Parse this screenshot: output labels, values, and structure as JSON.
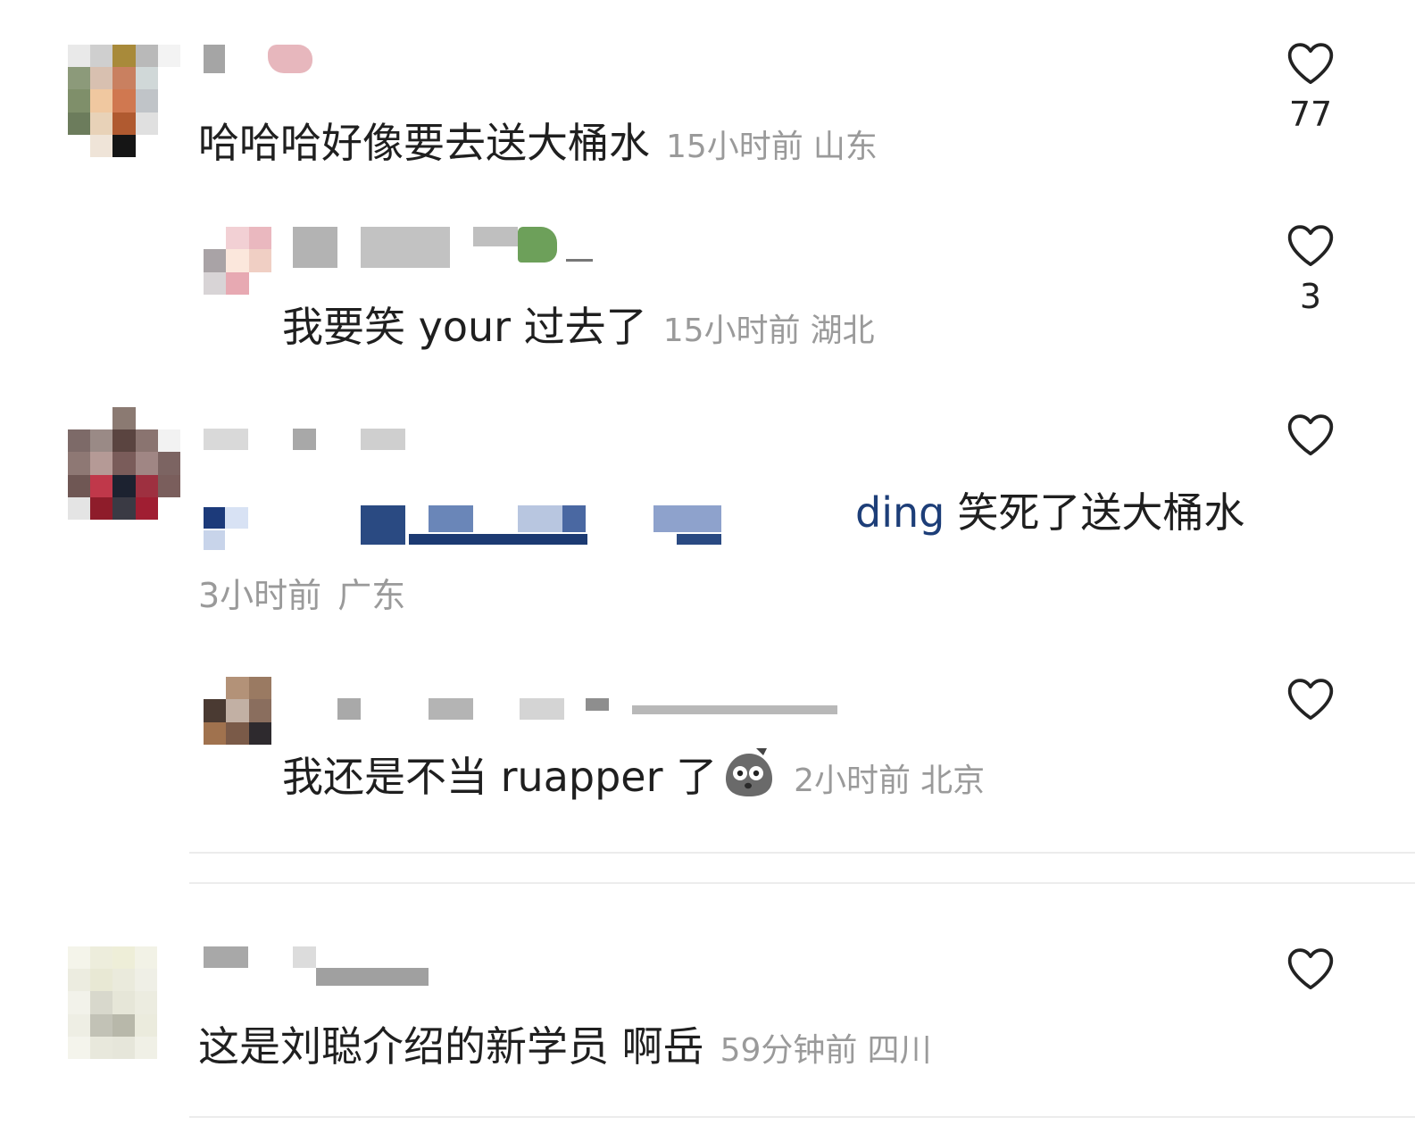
{
  "comments": [
    {
      "text": "哈哈哈好像要去送大桶水",
      "time": "15小时前",
      "location": "山东",
      "likes": "77"
    },
    {
      "text": "我要笑 your 过去了",
      "time": "15小时前",
      "location": "湖北",
      "likes": "3"
    },
    {
      "mention_suffix": "ding",
      "text": "笑死了送大桶水",
      "time": "3小时前",
      "location": "广东"
    },
    {
      "text": "我还是不当 ruapper 了",
      "emoji": "bag-face-emoji",
      "time": "2小时前",
      "location": "北京"
    },
    {
      "text": "这是刘聪介绍的新学员 啊岳",
      "time": "59分钟前",
      "location": "四川"
    }
  ],
  "icons": {
    "like": "heart-outline-icon"
  },
  "colors": {
    "text": "#1f1f1f",
    "meta": "#9a9a9a",
    "mention": "#1d3e78",
    "divider": "#ececec"
  }
}
